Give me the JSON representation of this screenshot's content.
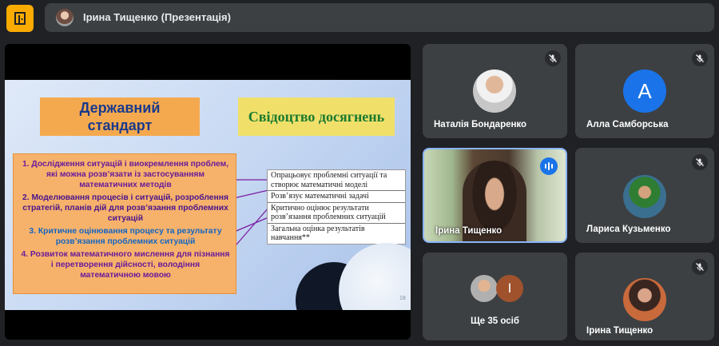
{
  "meeting": {
    "presenter_title": "Ірина Тищенко (Презентація)",
    "app_icon": "door-icon",
    "accent_color": "#f9ab00"
  },
  "slide": {
    "left_heading": "Державний стандарт",
    "right_heading": "Свідоцтво досягнень",
    "steps": [
      "1. Дослідження ситуацій і виокремлення проблем, які можна розв’язати із застосуванням математичних методів",
      "2. Моделювання процесів і ситуацій, розроблення стратегій, планів дій для розв’язання проблемних ситуацій",
      "3. Критичне оцінювання процесу та результату розв’язання проблемних ситуацій",
      "4. Розвиток математичного мислення для пізнання і перетворення дійсності, володіння математичною мовою"
    ],
    "criteria": [
      "Опрацьовує проблемні ситуації та створює математичні моделі",
      "Розв’язує математичні задачі",
      "Критично оцінює результати розв’язання проблемних ситуацій",
      "Загальна оцінка результатів навчання**"
    ],
    "page_number": "18"
  },
  "participants": [
    {
      "name": "Наталія Бондаренко",
      "muted": true,
      "avatar": "photo"
    },
    {
      "name": "Алла Самборська",
      "muted": true,
      "avatar": "A"
    },
    {
      "name": "Ірина Тищенко",
      "muted": false,
      "speaking": true,
      "avatar": "video"
    },
    {
      "name": "Лариса Кузьменко",
      "muted": true,
      "avatar": "photo"
    },
    {
      "name": "Ще 35 осіб",
      "avatar": "group",
      "extra_letter": "I"
    },
    {
      "name": "Ірина Тищенко",
      "muted": true,
      "avatar": "photo"
    }
  ],
  "icons": {
    "mute": "mic-off-icon",
    "speaking": "audio-level-icon"
  }
}
